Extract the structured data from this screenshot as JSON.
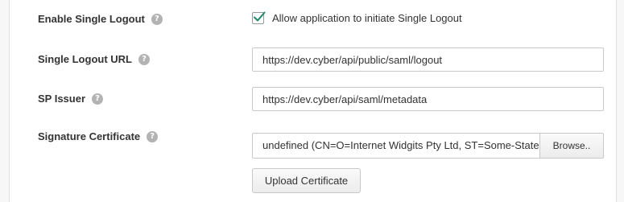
{
  "fields": {
    "single_logout": {
      "label": "Enable Single Logout",
      "checkbox_label": "Allow application to initiate Single Logout",
      "checked": true
    },
    "logout_url": {
      "label": "Single Logout URL",
      "value": "https://dev.cyber/api/public/saml/logout"
    },
    "sp_issuer": {
      "label": "SP Issuer",
      "value": "https://dev.cyber/api/saml/metadata"
    },
    "signature_certificate": {
      "label": "Signature Certificate",
      "file_name": "undefined (CN=O=Internet Widgits Pty Ltd, ST=Some-State",
      "browse_label": "Browse..",
      "upload_label": "Upload Certificate"
    }
  },
  "help_icon_glyph": "?",
  "colors": {
    "checkmark": "#1d8a6e",
    "help_icon": "#b3b3b3"
  }
}
